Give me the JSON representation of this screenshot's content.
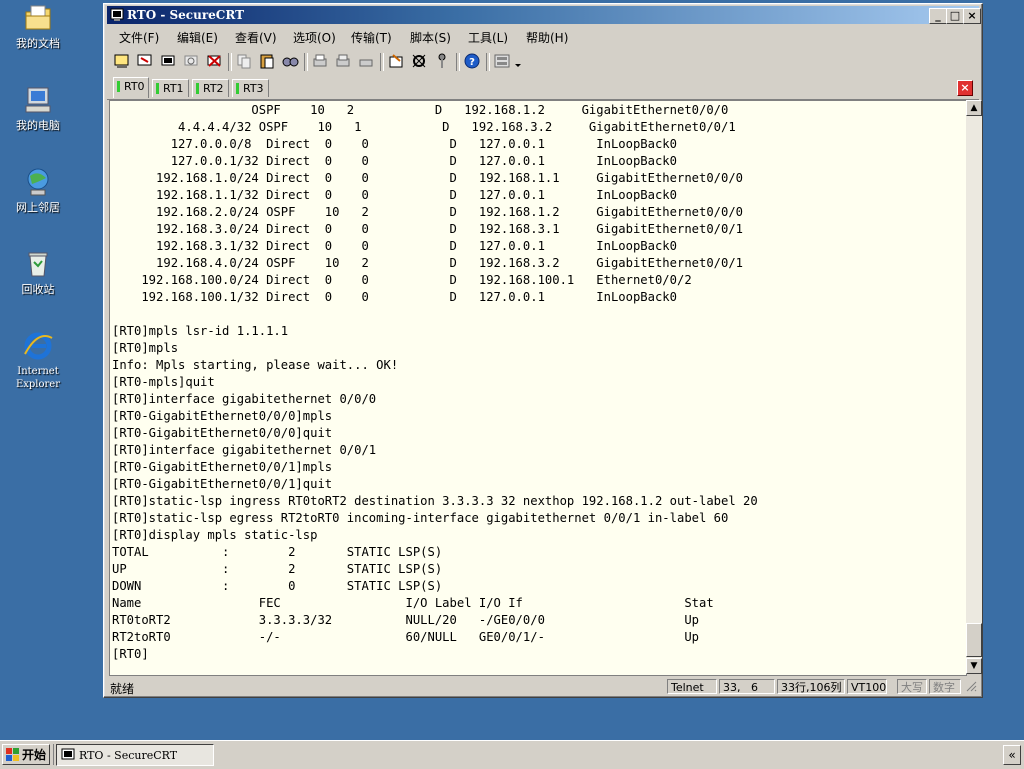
{
  "desktop": {
    "icons": [
      {
        "label": "我的文档",
        "icon": "my-documents-icon"
      },
      {
        "label": "我的电脑",
        "icon": "my-computer-icon"
      },
      {
        "label": "网上邻居",
        "icon": "network-places-icon"
      },
      {
        "label": "回收站",
        "icon": "recycle-bin-icon"
      },
      {
        "label": "Internet\nExplorer",
        "icon": "internet-explorer-icon"
      }
    ]
  },
  "window": {
    "title": "RTO - SecureCRT",
    "controls": {
      "minimize": "_",
      "maximize": "□",
      "close": "×"
    }
  },
  "menu": [
    "文件(F)",
    "编辑(E)",
    "查看(V)",
    "选项(O)",
    "传输(T)",
    "脚本(S)",
    "工具(L)",
    "帮助(H)"
  ],
  "tabs": [
    {
      "label": "RT0",
      "active": true
    },
    {
      "label": "RT1",
      "active": false
    },
    {
      "label": "RT2",
      "active": false
    },
    {
      "label": "RT3",
      "active": false
    }
  ],
  "terminal": {
    "lines": [
      "                   OSPF    10   2           D   192.168.1.2     GigabitEthernet0/0/0",
      "         4.4.4.4/32 OSPF    10   1           D   192.168.3.2     GigabitEthernet0/0/1",
      "        127.0.0.0/8  Direct  0    0           D   127.0.0.1       InLoopBack0",
      "        127.0.0.1/32 Direct  0    0           D   127.0.0.1       InLoopBack0",
      "      192.168.1.0/24 Direct  0    0           D   192.168.1.1     GigabitEthernet0/0/0",
      "      192.168.1.1/32 Direct  0    0           D   127.0.0.1       InLoopBack0",
      "      192.168.2.0/24 OSPF    10   2           D   192.168.1.2     GigabitEthernet0/0/0",
      "      192.168.3.0/24 Direct  0    0           D   192.168.3.1     GigabitEthernet0/0/1",
      "      192.168.3.1/32 Direct  0    0           D   127.0.0.1       InLoopBack0",
      "      192.168.4.0/24 OSPF    10   2           D   192.168.3.2     GigabitEthernet0/0/1",
      "    192.168.100.0/24 Direct  0    0           D   192.168.100.1   Ethernet0/0/2",
      "    192.168.100.1/32 Direct  0    0           D   127.0.0.1       InLoopBack0",
      "",
      "[RT0]mpls lsr-id 1.1.1.1",
      "[RT0]mpls",
      "Info: Mpls starting, please wait... OK!",
      "[RT0-mpls]quit",
      "[RT0]interface gigabitethernet 0/0/0",
      "[RT0-GigabitEthernet0/0/0]mpls",
      "[RT0-GigabitEthernet0/0/0]quit",
      "[RT0]interface gigabitethernet 0/0/1",
      "[RT0-GigabitEthernet0/0/1]mpls",
      "[RT0-GigabitEthernet0/0/1]quit",
      "[RT0]static-lsp ingress RT0toRT2 destination 3.3.3.3 32 nexthop 192.168.1.2 out-label 20",
      "[RT0]static-lsp egress RT2toRT0 incoming-interface gigabitethernet 0/0/1 in-label 60",
      "[RT0]display mpls static-lsp",
      "TOTAL          :        2       STATIC LSP(S)",
      "UP             :        2       STATIC LSP(S)",
      "DOWN           :        0       STATIC LSP(S)",
      "Name                FEC                 I/O Label I/O If                      Stat",
      "RT0toRT2            3.3.3.3/32          NULL/20   -/GE0/0/0                   Up",
      "RT2toRT0            -/-                 60/NULL   GE0/0/1/-                   Up",
      "[RT0]"
    ]
  },
  "status": {
    "ready": "就绪",
    "protocol": "Telnet",
    "cursor": "33,   6",
    "position": "33行,106列",
    "emulation": "VT100",
    "caps": "大写",
    "num": "数字"
  },
  "taskbar": {
    "start": "开始",
    "task": "RTO - SecureCRT",
    "tray": "«"
  }
}
